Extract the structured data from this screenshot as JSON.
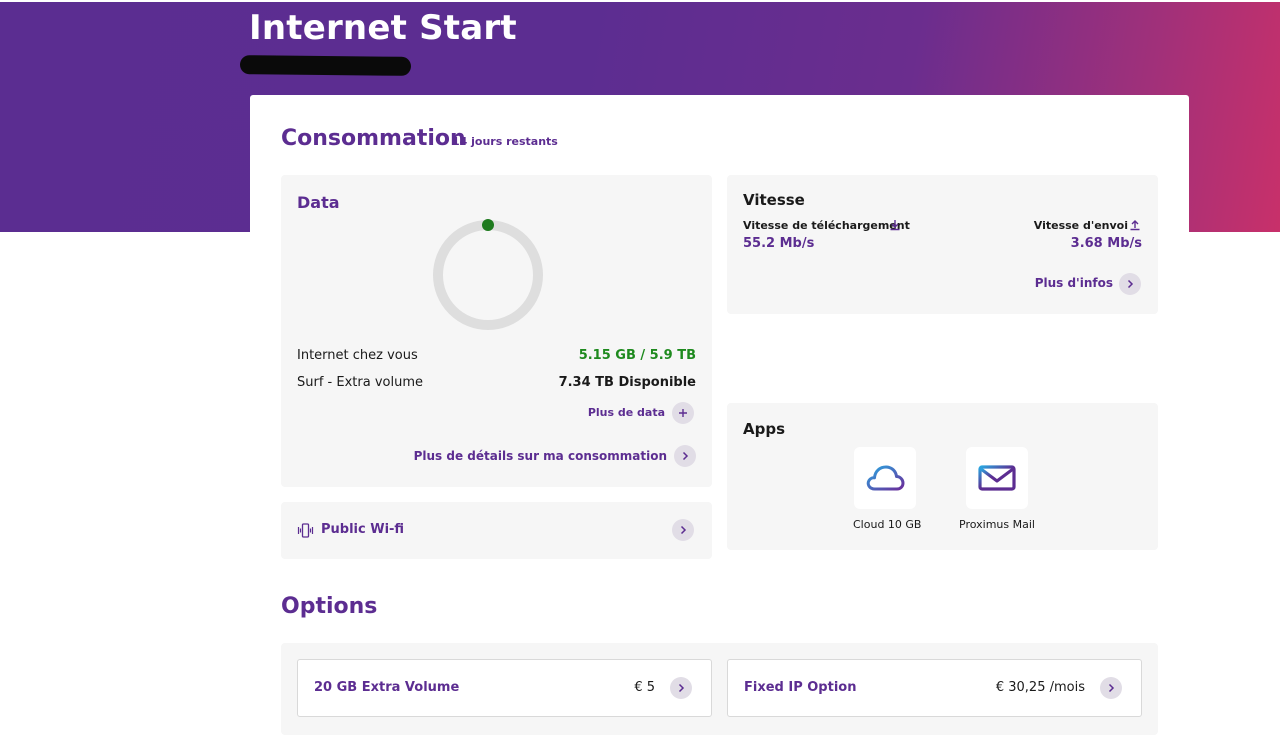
{
  "header": {
    "title": "Internet Start"
  },
  "consumption": {
    "title": "Consommation",
    "remaining": "14 jours restants",
    "data": {
      "title": "Data",
      "usage_fraction": 0.0,
      "rows": [
        {
          "label": "Internet chez vous",
          "value": "5.15 GB / 5.9 TB",
          "color": "#1e8a1e"
        },
        {
          "label": "Surf - Extra volume",
          "value": "7.34 TB Disponible",
          "color": "#1a1a1a"
        }
      ],
      "more_data_label": "Plus de data",
      "details_label": "Plus de détails sur ma consommation"
    },
    "speed": {
      "title": "Vitesse",
      "download_label": "Vitesse de téléchargement",
      "download_value": "55.2 Mb/s",
      "upload_label": "Vitesse d'envoi",
      "upload_value": "3.68 Mb/s",
      "more_info_label": "Plus d'infos"
    },
    "public_wifi": {
      "label": "Public Wi-fi"
    },
    "apps": {
      "title": "Apps",
      "items": [
        {
          "label": "Cloud 10 GB",
          "icon": "cloud-icon"
        },
        {
          "label": "Proximus Mail",
          "icon": "mail-icon"
        }
      ]
    }
  },
  "options": {
    "title": "Options",
    "items": [
      {
        "name": "20 GB Extra Volume",
        "price": "€ 5"
      },
      {
        "name": "Fixed IP Option",
        "price": "€ 30,25 /mois"
      }
    ]
  },
  "colors": {
    "brand": "#5c2d91",
    "accent_pink": "#c8306a",
    "green": "#1e8a1e"
  }
}
